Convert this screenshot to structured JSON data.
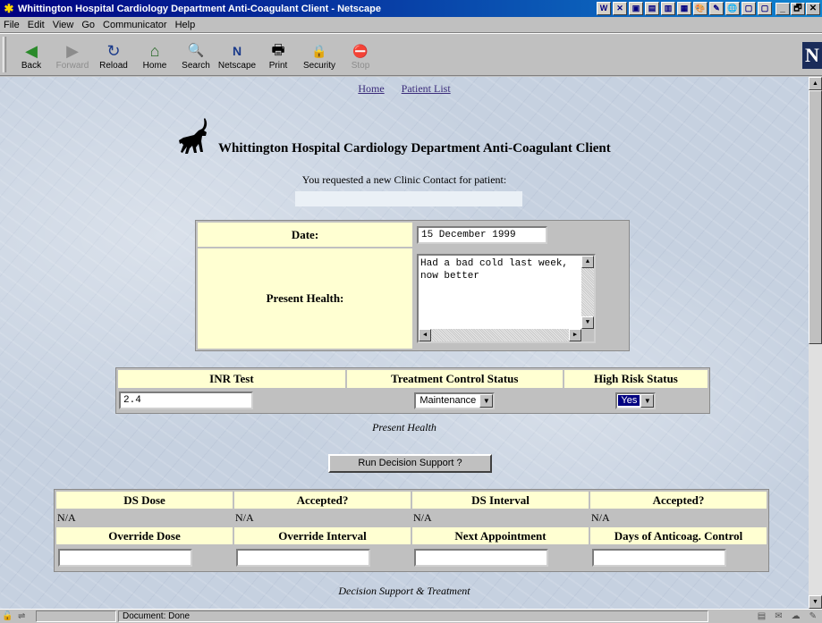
{
  "window": {
    "title": "Whittington Hospital Cardiology Department Anti-Coagulant Client - Netscape",
    "buttons": [
      "_",
      "🗗",
      "✕"
    ],
    "tray": [
      "W",
      "✕",
      "▣",
      "▤",
      "▥",
      "▦",
      "🎨",
      "✎",
      "🌐",
      "▢",
      "▢"
    ]
  },
  "menu": [
    "File",
    "Edit",
    "View",
    "Go",
    "Communicator",
    "Help"
  ],
  "toolbar": {
    "buttons": [
      {
        "label": "Back",
        "icon": "◀"
      },
      {
        "label": "Forward",
        "icon": "▶"
      },
      {
        "label": "Reload",
        "icon": "↻"
      },
      {
        "label": "Home",
        "icon": "⌂"
      },
      {
        "label": "Search",
        "icon": "🔍"
      },
      {
        "label": "Netscape",
        "icon": "N"
      },
      {
        "label": "Print",
        "icon": "🖶"
      },
      {
        "label": "Security",
        "icon": "🔒"
      },
      {
        "label": "Stop",
        "icon": "⛔"
      }
    ]
  },
  "page": {
    "nav": {
      "home": "Home",
      "patient_list": "Patient List"
    },
    "heading": "Whittington Hospital Cardiology Department Anti-Coagulant Client",
    "requested_text": "You requested a new Clinic Contact for patient:",
    "contact": {
      "date_label": "Date:",
      "date_value": "15 December 1999",
      "health_label": "Present Health:",
      "health_value": "Had a bad cold last week,\nnow better"
    },
    "status_table": {
      "headers": [
        "INR Test",
        "Treatment Control Status",
        "High Risk Status"
      ],
      "inr_value": "2.4",
      "treatment_value": "Maintenance",
      "high_risk_value": "Yes"
    },
    "present_health_caption": "Present Health",
    "run_button": "Run Decision Support ?",
    "ds_table": {
      "headers_row1": [
        "DS Dose",
        "Accepted?",
        "DS Interval",
        "Accepted?"
      ],
      "values_row1": [
        "N/A",
        "N/A",
        "N/A",
        "N/A"
      ],
      "headers_row2": [
        "Override Dose",
        "Override Interval",
        "Next Appointment",
        "Days of Anticoag. Control"
      ]
    },
    "ds_caption": "Decision Support & Treatment"
  },
  "statusbar": {
    "text": "Document: Done"
  },
  "colors": {
    "label_bg": "#ffffd2",
    "link": "#3b2c7a",
    "title_bar": "#000080"
  }
}
